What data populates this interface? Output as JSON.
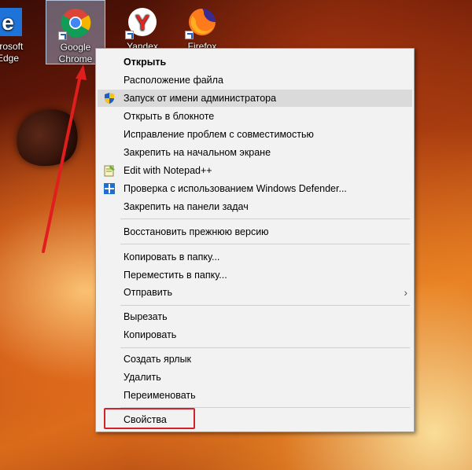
{
  "desktop": {
    "icons": [
      {
        "label_line1": "icrosoft",
        "label_line2": "Edge"
      },
      {
        "label_line1": "Google",
        "label_line2": "Chrome"
      },
      {
        "label_line1": "Yandex",
        "label_line2": ""
      },
      {
        "label_line1": "Firefox",
        "label_line2": ""
      }
    ]
  },
  "context_menu": {
    "items": [
      {
        "label": "Открыть",
        "bold": true
      },
      {
        "label": "Расположение файла"
      },
      {
        "label": "Запуск от имени администратора",
        "icon": "uac-shield-icon",
        "highlighted": true
      },
      {
        "label": "Открыть в блокноте"
      },
      {
        "label": "Исправление проблем с совместимостью"
      },
      {
        "label": "Закрепить на начальном экране"
      },
      {
        "label": "Edit with Notepad++",
        "icon": "notepad-plus-plus-icon"
      },
      {
        "label": "Проверка с использованием Windows Defender...",
        "icon": "windows-defender-icon"
      },
      {
        "label": "Закрепить на панели задач"
      },
      {
        "label": "Восстановить прежнюю версию"
      },
      {
        "label": "Копировать в папку..."
      },
      {
        "label": "Переместить в папку..."
      },
      {
        "label": "Отправить",
        "submenu": true
      },
      {
        "label": "Вырезать"
      },
      {
        "label": "Копировать"
      },
      {
        "label": "Создать ярлык"
      },
      {
        "label": "Удалить"
      },
      {
        "label": "Переименовать"
      },
      {
        "label": "Свойства",
        "annotated": true
      }
    ]
  },
  "colors": {
    "annotation": "#d2232a",
    "highlight": "#dadada",
    "menu_bg": "#f2f2f2"
  }
}
